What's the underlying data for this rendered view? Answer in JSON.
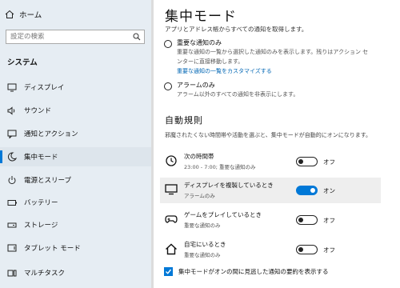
{
  "sidebar": {
    "home_label": "ホーム",
    "search_placeholder": "設定の検索",
    "section_title": "システム",
    "items": [
      {
        "label": "ディスプレイ",
        "icon": "display-icon"
      },
      {
        "label": "サウンド",
        "icon": "speaker-icon"
      },
      {
        "label": "通知とアクション",
        "icon": "notification-icon"
      },
      {
        "label": "集中モード",
        "icon": "moon-icon",
        "active": true
      },
      {
        "label": "電源とスリープ",
        "icon": "power-icon"
      },
      {
        "label": "バッテリー",
        "icon": "battery-icon"
      },
      {
        "label": "ストレージ",
        "icon": "storage-icon"
      },
      {
        "label": "タブレット モード",
        "icon": "tablet-icon"
      },
      {
        "label": "マルチタスク",
        "icon": "multitask-icon"
      }
    ]
  },
  "main": {
    "title": "集中モード",
    "subtitle": "アプリとアドレス帳からすべての通知を取得します。",
    "options": [
      {
        "title": "重要な通知のみ",
        "desc_line1": "重要な通知の一覧から選択した通知のみを表示します。残りはアクション セ",
        "desc_line2": "ンターに直接移動します。",
        "link": "重要な通知の一覧をカスタマイズする"
      },
      {
        "title": "アラームのみ",
        "desc_line1": "アラーム以外のすべての通知を非表示にします。"
      }
    ],
    "auto_rules_title": "自動規則",
    "auto_rules_desc": "邪魔されたくない時間帯や活動を選ぶと、集中モードが自動的にオンになります。",
    "rules": [
      {
        "name": "次の時間帯",
        "detail": "23:00 - 7:00; 重要な通知のみ",
        "state": "オフ",
        "on": false,
        "icon": "clock-icon"
      },
      {
        "name": "ディスプレイを複製しているとき",
        "detail": "アラームのみ",
        "state": "オン",
        "on": true,
        "icon": "monitor-icon"
      },
      {
        "name": "ゲームをプレイしているとき",
        "detail": "重要な通知のみ",
        "state": "オフ",
        "on": false,
        "icon": "gamepad-icon"
      },
      {
        "name": "自宅にいるとき",
        "detail": "重要な通知のみ",
        "state": "オフ",
        "on": false,
        "icon": "house-icon"
      }
    ],
    "summary_check_label": "集中モードがオンの間に見逃した通知の要約を表示する",
    "summary_checked": true
  },
  "colors": {
    "accent": "#0078d7",
    "link": "#0066b4",
    "sidebar_bg": "#e6edf3"
  }
}
